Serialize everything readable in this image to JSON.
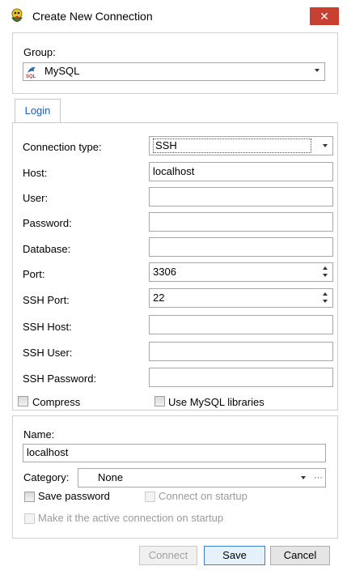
{
  "window": {
    "title": "Create New Connection",
    "close_glyph": "✕"
  },
  "group": {
    "label": "Group:",
    "value": "MySQL",
    "icon": "mysql-dolphin-icon"
  },
  "tabs": [
    {
      "label": "Login"
    }
  ],
  "login": {
    "connection_type": {
      "label": "Connection type:",
      "value": "SSH"
    },
    "host": {
      "label": "Host:",
      "value": "localhost"
    },
    "user": {
      "label": "User:",
      "value": ""
    },
    "password": {
      "label": "Password:",
      "value": ""
    },
    "database": {
      "label": "Database:",
      "value": ""
    },
    "port": {
      "label": "Port:",
      "value": "3306"
    },
    "ssh_port": {
      "label": "SSH Port:",
      "value": "22"
    },
    "ssh_host": {
      "label": "SSH Host:",
      "value": ""
    },
    "ssh_user": {
      "label": "SSH User:",
      "value": ""
    },
    "ssh_password": {
      "label": "SSH Password:",
      "value": ""
    },
    "compress": {
      "label": "Compress",
      "checked": false
    },
    "use_mysql_libraries": {
      "label": "Use MySQL libraries",
      "checked": false
    }
  },
  "settings": {
    "name": {
      "label": "Name:",
      "value": "localhost"
    },
    "category": {
      "label": "Category:",
      "value": "None",
      "more_glyph": "···"
    },
    "save_password": {
      "label": "Save password",
      "checked": false
    },
    "connect_on_startup": {
      "label": "Connect on startup",
      "checked": false,
      "enabled": false
    },
    "active_on_startup": {
      "label": "Make it the active connection on startup",
      "checked": false,
      "enabled": false
    }
  },
  "buttons": {
    "connect": "Connect",
    "save": "Save",
    "cancel": "Cancel"
  },
  "colors": {
    "close_button": "#c84031",
    "tab_text": "#1f5fa8",
    "border": "#d0d0d0"
  }
}
